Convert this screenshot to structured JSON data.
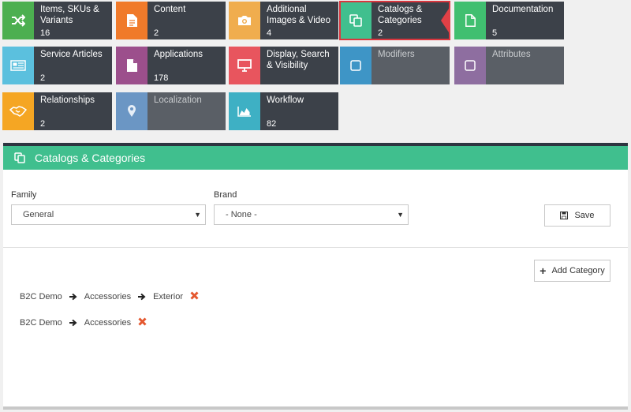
{
  "tiles": [
    {
      "label": "Items, SKUs & Variants",
      "count": "16",
      "color": "#4caf50",
      "icon": "shuffle-icon"
    },
    {
      "label": "Content",
      "count": "2",
      "color": "#f07a2a",
      "icon": "document-icon"
    },
    {
      "label": "Additional Images & Video",
      "count": "4",
      "color": "#f0ad4e",
      "icon": "camera-icon"
    },
    {
      "label": "Catalogs & Categories",
      "count": "2",
      "color": "#40bf8e",
      "icon": "copy-icon",
      "active": true
    },
    {
      "label": "Documentation",
      "count": "5",
      "color": "#40bf70",
      "icon": "file-icon"
    },
    {
      "label": "Service Articles",
      "count": "2",
      "color": "#5bc0de",
      "icon": "newspaper-icon"
    },
    {
      "label": "Applications",
      "count": "178",
      "color": "#9c4f8c",
      "icon": "file-solid-icon"
    },
    {
      "label": "Display, Search & Visibility",
      "count": "",
      "color": "#e8555e",
      "icon": "monitor-icon"
    },
    {
      "label": "Modifiers",
      "count": "",
      "color": "#3e95c6",
      "icon": "checkbox-icon",
      "disabled": true
    },
    {
      "label": "Attributes",
      "count": "",
      "color": "#8e6ea0",
      "icon": "checkbox-icon",
      "disabled": true
    },
    {
      "label": "Relationships",
      "count": "2",
      "color": "#f5a623",
      "icon": "handshake-icon"
    },
    {
      "label": "Localization",
      "count": "",
      "color": "#6b96c4",
      "icon": "map-pin-icon",
      "disabled": true
    },
    {
      "label": "Workflow",
      "count": "82",
      "color": "#3eb0c4",
      "icon": "area-chart-icon"
    }
  ],
  "panel": {
    "title": "Catalogs & Categories",
    "family_label": "Family",
    "family_value": "General",
    "brand_label": "Brand",
    "brand_value": "- None -",
    "save_label": "Save",
    "add_category_label": "Add Category",
    "paths": [
      [
        "B2C Demo",
        "Accessories",
        "Exterior"
      ],
      [
        "B2C Demo",
        "Accessories"
      ]
    ],
    "header_color": "#40bf8e",
    "delete_color": "#e4572e"
  }
}
